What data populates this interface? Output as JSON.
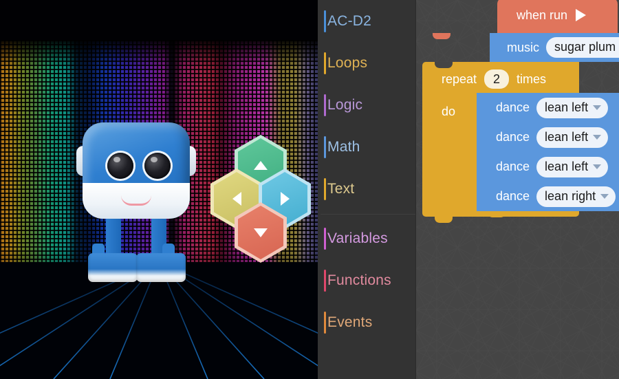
{
  "simulator": {
    "robot_name": "robot-avatar",
    "dpad": {
      "up": {
        "name": "up",
        "color": "#4fb98a"
      },
      "left": {
        "name": "left",
        "color": "#d4cb72"
      },
      "right": {
        "name": "right",
        "color": "#55bcd8"
      },
      "down": {
        "name": "down",
        "color": "#e0735d"
      }
    }
  },
  "toolbox": {
    "categories": [
      {
        "label": "AC-D2",
        "color": "#4a90d9",
        "text_color": "#8ab4e0"
      },
      {
        "label": "Loops",
        "color": "#e0a82c",
        "text_color": "#e0b254"
      },
      {
        "label": "Logic",
        "color": "#b06ad0",
        "text_color": "#b998d8"
      },
      {
        "label": "Math",
        "color": "#5b97dd",
        "text_color": "#9dc0e4"
      },
      {
        "label": "Text",
        "color": "#e0a82c",
        "text_color": "#ddc98e"
      },
      {
        "label": "Variables",
        "color": "#cf5fd0",
        "text_color": "#d49ae0"
      },
      {
        "label": "Functions",
        "color": "#e0476b",
        "text_color": "#e08a9e"
      },
      {
        "label": "Events",
        "color": "#e08a3c",
        "text_color": "#e0a878"
      }
    ]
  },
  "workspace": {
    "blocks": {
      "when_run": {
        "label": "when run",
        "icon": "play-icon",
        "color": "#e0755c"
      },
      "music": {
        "label": "music",
        "value": "sugar plum ballet",
        "color": "#5b97dd"
      },
      "repeat": {
        "label": "repeat",
        "count": "2",
        "times_label": "times",
        "do_label": "do",
        "color": "#e0a82c"
      },
      "dance_statements": [
        {
          "label": "dance",
          "value": "lean left",
          "color": "#5b97dd"
        },
        {
          "label": "dance",
          "value": "lean left",
          "color": "#5b97dd"
        },
        {
          "label": "dance",
          "value": "lean left",
          "color": "#5b97dd"
        },
        {
          "label": "dance",
          "value": "lean right",
          "color": "#5b97dd"
        }
      ]
    }
  }
}
